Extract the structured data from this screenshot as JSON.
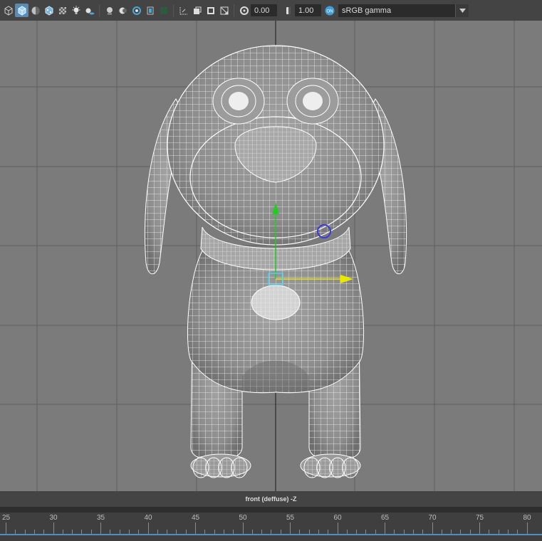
{
  "toolbar": {
    "icons": [
      "wireframe-cube-icon",
      "smooth-shade-cube-icon",
      "half-sphere-icon",
      "textured-cube-icon",
      "checker-icon",
      "light-bulb-icon",
      "shadow-icon",
      "xray-icon",
      "isolate-icon",
      "ambient-occlusion-icon",
      "motion-blur-icon",
      "antialias-icon",
      "grid-toggle-icon",
      "frame-icon",
      "image-plane-icon",
      "resolution-gate-icon",
      "exposure-icon",
      "gamma-icon",
      "color-management-icon"
    ],
    "exposure_value": "0.00",
    "gamma_value": "1.00",
    "colorspace": "sRGB gamma"
  },
  "viewport": {
    "background_color": "#7b7b7b",
    "grid_color": "#5a5a5a",
    "axis_color": "#3a3a3a",
    "wire_color": "#ffffff"
  },
  "camera_label": "front (deffuse) -Z",
  "timeline": {
    "ticks": [
      "25",
      "30",
      "35",
      "40",
      "45",
      "50",
      "55",
      "60",
      "65",
      "70",
      "75",
      "80"
    ],
    "accent_color": "#4f8fc0"
  }
}
